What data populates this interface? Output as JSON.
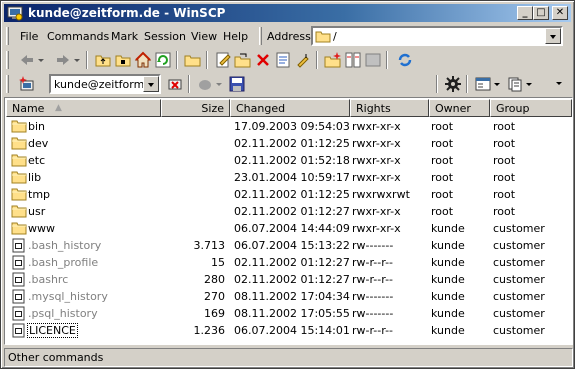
{
  "window": {
    "title": "kunde@zeitform.de - WinSCP"
  },
  "titlebar_buttons": {
    "minimize": "_",
    "maximize": "□",
    "close": "✕"
  },
  "menu": [
    "File",
    "Commands",
    "Mark",
    "Session",
    "View",
    "Help"
  ],
  "address": {
    "label": "Address",
    "value": "/"
  },
  "session": {
    "value": "kunde@zeitform.de"
  },
  "columns": [
    "Name",
    "Size",
    "Changed",
    "Rights",
    "Owner",
    "Group"
  ],
  "files": [
    {
      "name": "bin",
      "size": "",
      "changed": "17.09.2003 09:54:03",
      "rights": "rwxr-xr-x",
      "owner": "root",
      "group": "root",
      "type": "folder"
    },
    {
      "name": "dev",
      "size": "",
      "changed": "02.11.2002 01:12:25",
      "rights": "rwxr-xr-x",
      "owner": "root",
      "group": "root",
      "type": "folder"
    },
    {
      "name": "etc",
      "size": "",
      "changed": "02.11.2002 01:52:18",
      "rights": "rwxr-xr-x",
      "owner": "root",
      "group": "root",
      "type": "folder"
    },
    {
      "name": "lib",
      "size": "",
      "changed": "23.01.2004 10:59:17",
      "rights": "rwxr-xr-x",
      "owner": "root",
      "group": "root",
      "type": "folder"
    },
    {
      "name": "tmp",
      "size": "",
      "changed": "02.11.2002 01:12:25",
      "rights": "rwxrwxrwt",
      "owner": "root",
      "group": "root",
      "type": "folder"
    },
    {
      "name": "usr",
      "size": "",
      "changed": "02.11.2002 01:12:27",
      "rights": "rwxr-xr-x",
      "owner": "root",
      "group": "root",
      "type": "folder"
    },
    {
      "name": "www",
      "size": "",
      "changed": "06.07.2004 14:44:09",
      "rights": "rwxr-xr-x",
      "owner": "kunde",
      "group": "customer",
      "type": "folder"
    },
    {
      "name": ".bash_history",
      "size": "3.713",
      "changed": "06.07.2004 15:13:22",
      "rights": "rw-------",
      "owner": "kunde",
      "group": "customer",
      "type": "file"
    },
    {
      "name": ".bash_profile",
      "size": "15",
      "changed": "02.11.2002 01:12:27",
      "rights": "rw-r--r--",
      "owner": "kunde",
      "group": "customer",
      "type": "file"
    },
    {
      "name": ".bashrc",
      "size": "280",
      "changed": "02.11.2002 01:12:27",
      "rights": "rw-r--r--",
      "owner": "kunde",
      "group": "customer",
      "type": "file"
    },
    {
      "name": ".mysql_history",
      "size": "270",
      "changed": "08.11.2002 17:04:34",
      "rights": "rw-------",
      "owner": "kunde",
      "group": "customer",
      "type": "file"
    },
    {
      "name": ".psql_history",
      "size": "169",
      "changed": "08.11.2002 17:05:55",
      "rights": "rw-------",
      "owner": "kunde",
      "group": "customer",
      "type": "file"
    },
    {
      "name": "LICENCE",
      "size": "1.236",
      "changed": "06.07.2004 15:14:01",
      "rights": "rw-r--r--",
      "owner": "kunde",
      "group": "customer",
      "type": "file"
    }
  ],
  "status": "Other commands"
}
